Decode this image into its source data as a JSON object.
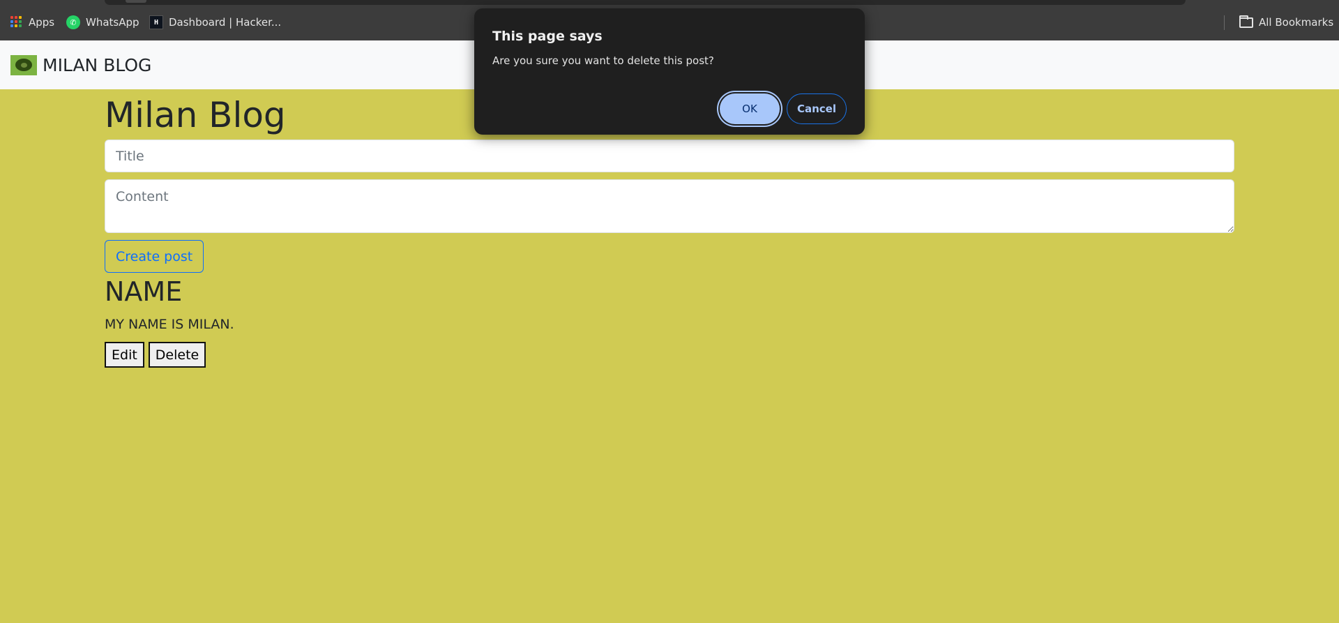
{
  "bookmarks": {
    "items": [
      {
        "label": "Apps",
        "icon": "apps-grid-icon"
      },
      {
        "label": "WhatsApp",
        "icon": "whatsapp-icon"
      },
      {
        "label": "Dashboard | Hacker...",
        "icon": "hackerrank-icon"
      }
    ],
    "all_bookmarks": {
      "label": "All Bookmarks",
      "icon": "folder-icon"
    }
  },
  "navbar": {
    "brand": "MILAN BLOG",
    "logo": "brand-logo-icon"
  },
  "main": {
    "title": "Milan Blog",
    "title_placeholder": "Title",
    "content_placeholder": "Content",
    "create_button": "Create post"
  },
  "posts": [
    {
      "title": "NAME",
      "content": "MY NAME IS MILAN.",
      "edit_label": "Edit",
      "delete_label": "Delete"
    }
  ],
  "dialog": {
    "title": "This page says",
    "message": "Are you sure you want to delete this post?",
    "ok_label": "OK",
    "cancel_label": "Cancel"
  },
  "colors": {
    "page_background": "#d0cb53",
    "navbar_background": "#f8f9fa",
    "bookmarks_bar": "#3c3c3c",
    "dialog_background": "#1f1f1f",
    "primary": "#0d6efd",
    "dialog_accent": "#a8c7fa"
  }
}
